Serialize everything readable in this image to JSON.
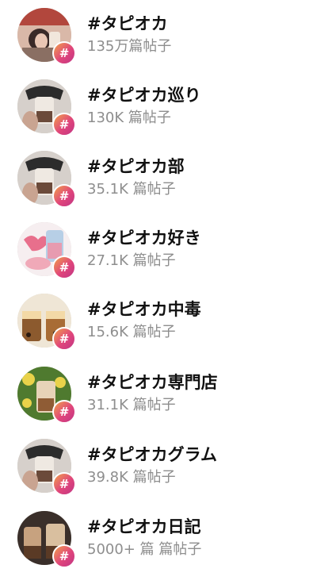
{
  "hashtags": [
    {
      "tag": "#タピオカ",
      "posts": "135万篇帖子",
      "badge": "#",
      "avatar": "avatar-drink-1"
    },
    {
      "tag": "#タピオカ巡り",
      "posts": "130K 篇帖子",
      "badge": "#",
      "avatar": "avatar-drink-2"
    },
    {
      "tag": "#タピオカ部",
      "posts": "35.1K 篇帖子",
      "badge": "#",
      "avatar": "avatar-drink-2"
    },
    {
      "tag": "#タピオカ好き",
      "posts": "27.1K 篇帖子",
      "badge": "#",
      "avatar": "avatar-drink-3"
    },
    {
      "tag": "#タピオカ中毒",
      "posts": "15.6K 篇帖子",
      "badge": "#",
      "avatar": "avatar-drink-4"
    },
    {
      "tag": "#タピオカ専門店",
      "posts": "31.1K 篇帖子",
      "badge": "#",
      "avatar": "avatar-drink-5"
    },
    {
      "tag": "#タピオカグラム",
      "posts": "39.8K 篇帖子",
      "badge": "#",
      "avatar": "avatar-drink-2"
    },
    {
      "tag": "#タピオカ日記",
      "posts": "5000+ 篇 篇帖子",
      "badge": "#",
      "avatar": "avatar-drink-6"
    }
  ],
  "colors": {
    "tag_text": "#111111",
    "count_text": "#8e8e8e",
    "badge_gradient": [
      "#f0a24a",
      "#e0457b",
      "#c13584"
    ]
  }
}
